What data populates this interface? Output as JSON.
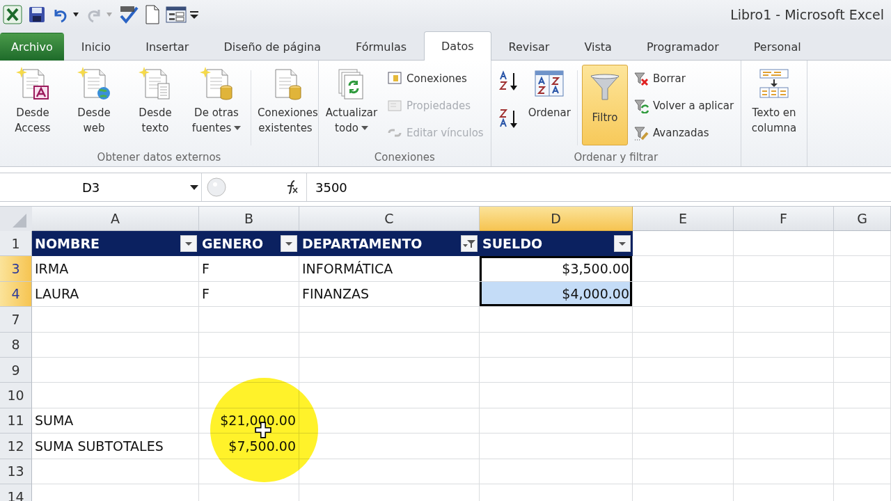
{
  "window": {
    "title": "Libro1  -  Microsoft Excel"
  },
  "tabs": [
    {
      "label": "Archivo",
      "kind": "file",
      "selected": false
    },
    {
      "label": "Inicio",
      "selected": false
    },
    {
      "label": "Insertar",
      "selected": false
    },
    {
      "label": "Diseño de página",
      "selected": false
    },
    {
      "label": "Fórmulas",
      "selected": false
    },
    {
      "label": "Datos",
      "selected": true
    },
    {
      "label": "Revisar",
      "selected": false
    },
    {
      "label": "Vista",
      "selected": false
    },
    {
      "label": "Programador",
      "selected": false
    },
    {
      "label": "Personal",
      "selected": false
    }
  ],
  "ribbon": {
    "groups": [
      {
        "label": "Obtener datos externos",
        "items": [
          {
            "kind": "large",
            "label": "Desde Access"
          },
          {
            "kind": "large",
            "label": "Desde web"
          },
          {
            "kind": "large",
            "label": "Desde texto"
          },
          {
            "kind": "large",
            "label": "De otras fuentes",
            "dropdown": true
          },
          {
            "kind": "separator"
          },
          {
            "kind": "large",
            "label": "Conexiones existentes"
          }
        ]
      },
      {
        "label": "Conexiones",
        "items": [
          {
            "kind": "large",
            "label": "Actualizar todo",
            "dropdown": true
          },
          {
            "kind": "stack",
            "buttons": [
              {
                "label": "Conexiones",
                "disabled": false
              },
              {
                "label": "Propiedades",
                "disabled": true
              },
              {
                "label": "Editar vínculos",
                "disabled": true
              }
            ]
          }
        ]
      },
      {
        "label": "Ordenar y filtrar",
        "items": [
          {
            "kind": "sort_pair"
          },
          {
            "kind": "large",
            "label": "Ordenar"
          },
          {
            "kind": "separator"
          },
          {
            "kind": "large",
            "label": "Filtro",
            "on": true
          },
          {
            "kind": "stack",
            "buttons": [
              {
                "label": "Borrar",
                "disabled": false
              },
              {
                "label": "Volver a aplicar",
                "disabled": false
              },
              {
                "label": "Avanzadas",
                "disabled": false
              }
            ]
          }
        ]
      },
      {
        "items": [
          {
            "kind": "large",
            "label": "Texto en columna"
          }
        ]
      }
    ]
  },
  "formula_bar": {
    "name_box": "D3",
    "formula": "3500"
  },
  "columns": [
    {
      "letter": "A",
      "selected": false
    },
    {
      "letter": "B",
      "selected": false
    },
    {
      "letter": "C",
      "selected": false
    },
    {
      "letter": "D",
      "selected": true
    },
    {
      "letter": "E",
      "selected": false
    },
    {
      "letter": "F",
      "selected": false
    },
    {
      "letter": "G",
      "selected": false
    }
  ],
  "rows": [
    {
      "number": "1",
      "selected": false,
      "kind": "table_header",
      "cells": [
        {
          "text": "NOMBRE",
          "filtered": false
        },
        {
          "text": "GENERO",
          "filtered": false
        },
        {
          "text": "DEPARTAMENTO",
          "filtered": true
        },
        {
          "text": "SUELDO",
          "filtered": false
        }
      ]
    },
    {
      "number": "3",
      "selected": true,
      "cells": [
        {
          "text": "IRMA"
        },
        {
          "text": "F"
        },
        {
          "text": "INFORMÁTICA"
        },
        {
          "text": "$3,500.00",
          "numeric": true,
          "selected": true,
          "active": true
        }
      ]
    },
    {
      "number": "4",
      "selected": true,
      "cells": [
        {
          "text": "LAURA"
        },
        {
          "text": "F"
        },
        {
          "text": "FINANZAS"
        },
        {
          "text": "$4,000.00",
          "numeric": true,
          "selected": true,
          "active": false
        }
      ]
    },
    {
      "number": "7",
      "selected": false
    },
    {
      "number": "8",
      "selected": false
    },
    {
      "number": "9",
      "selected": false
    },
    {
      "number": "10",
      "selected": false
    },
    {
      "number": "11",
      "selected": false,
      "cells": [
        {
          "text": "SUMA"
        },
        {
          "text": "$21,000.00",
          "numeric": true
        }
      ]
    },
    {
      "number": "12",
      "selected": false,
      "cells": [
        {
          "text": "SUMA SUBTOTALES"
        },
        {
          "text": "$7,500.00",
          "numeric": true
        }
      ]
    },
    {
      "number": "13",
      "selected": false
    },
    {
      "number": "14",
      "selected": false
    }
  ]
}
